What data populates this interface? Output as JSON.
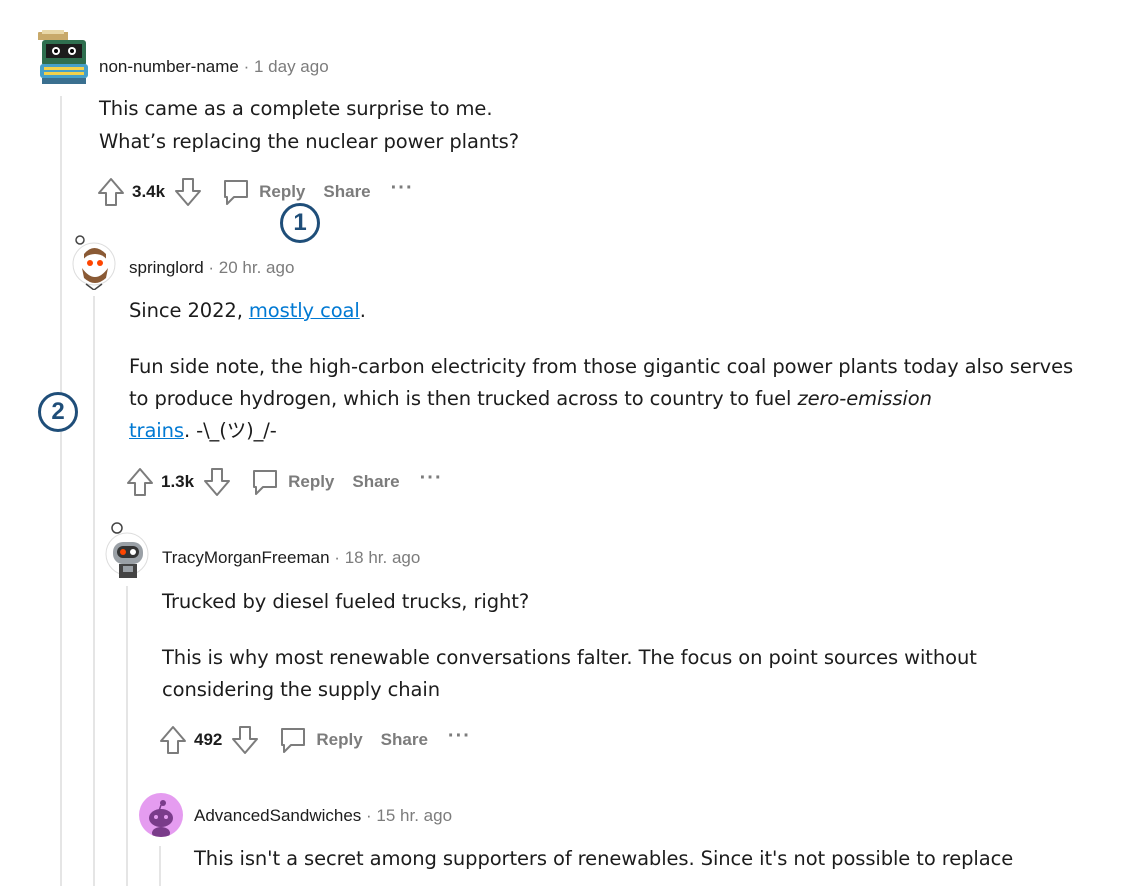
{
  "comments": [
    {
      "username": "non-number-name",
      "time": "1 day ago",
      "lines": [
        "This came as a complete surprise to me.",
        "What’s replacing the nuclear power plants?"
      ],
      "score": "3.4k",
      "reply": "Reply",
      "share": "Share",
      "more": "···",
      "avatar_icon": "typewriter-avatar-icon"
    },
    {
      "username": "springlord",
      "time": "20 hr. ago",
      "p1_before": "Since 2022, ",
      "p1_link": "mostly coal",
      "p1_after": ".",
      "p2_text": "Fun side note, the high-carbon electricity from those gigantic coal power plants today also serves to produce hydrogen, which is then trucked across to country to fuel ",
      "p2_italic": "zero-emission",
      "p2_link": "trains",
      "p2_after": ". -\\_(ツ)_/-",
      "score": "1.3k",
      "reply": "Reply",
      "share": "Share",
      "more": "···",
      "avatar_icon": "snoo-bearded-avatar-icon"
    },
    {
      "username": "TracyMorganFreeman",
      "time": "18 hr. ago",
      "p1": "Trucked by diesel fueled trucks, right?",
      "p2": "This is why most renewable conversations falter. The focus on point sources without considering the supply chain",
      "score": "492",
      "reply": "Reply",
      "share": "Share",
      "more": "···",
      "avatar_icon": "snoo-robot-avatar-icon"
    },
    {
      "username": "AdvancedSandwiches",
      "time": "15 hr. ago",
      "p1": "This isn't a secret among supporters of renewables. Since it's not possible to replace",
      "avatar_icon": "snoo-default-avatar-icon"
    }
  ],
  "separator": "·",
  "markers": [
    "1",
    "2"
  ],
  "colors": {
    "link": "#0079d3",
    "muted": "#7c7c7c",
    "marker": "#1f4e79",
    "thread_line": "#e5e5e5"
  }
}
